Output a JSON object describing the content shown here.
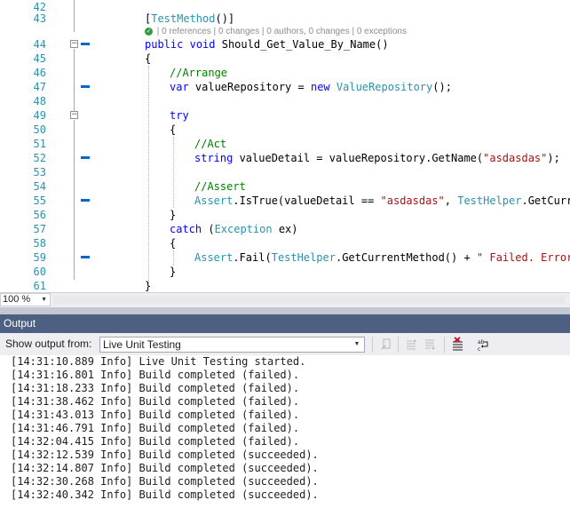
{
  "editor": {
    "lines": [
      {
        "num": "42",
        "code": ""
      },
      {
        "num": "43",
        "code": "    [TestMethod()]"
      },
      {
        "num": "44",
        "code": "    public void Should_Get_Value_By_Name()"
      },
      {
        "num": "45",
        "code": "    {"
      },
      {
        "num": "46",
        "code": "        //Arrange"
      },
      {
        "num": "47",
        "code": "        var valueRepository = new ValueRepository();"
      },
      {
        "num": "48",
        "code": ""
      },
      {
        "num": "49",
        "code": "        try"
      },
      {
        "num": "50",
        "code": "        {"
      },
      {
        "num": "51",
        "code": "            //Act"
      },
      {
        "num": "52",
        "code": "            string valueDetail = valueRepository.GetName(\"asdasdas\");"
      },
      {
        "num": "53",
        "code": ""
      },
      {
        "num": "54",
        "code": "            //Assert"
      },
      {
        "num": "55",
        "code": "            Assert.IsTrue(valueDetail == \"asdasdas\", TestHelper.GetCurrentMethod() + \" Failed\");"
      },
      {
        "num": "56",
        "code": "        }"
      },
      {
        "num": "57",
        "code": "        catch (Exception ex)"
      },
      {
        "num": "58",
        "code": "        {"
      },
      {
        "num": "59",
        "code": "            Assert.Fail(TestHelper.GetCurrentMethod() + \" Failed. Error: \" + ex.Message);"
      },
      {
        "num": "60",
        "code": "        }"
      },
      {
        "num": "61",
        "code": "    }"
      }
    ],
    "codelens": [
      "0 references",
      "0 changes",
      "0 authors, 0 changes",
      "0 exceptions"
    ],
    "zoom": "100 %"
  },
  "output": {
    "title": "Output",
    "show_output_from_label": "Show output from:",
    "selected_source": "Live Unit Testing",
    "lines": [
      "[14:31:10.889 Info] Live Unit Testing started.",
      "[14:31:16.801 Info] Build completed (failed).",
      "[14:31:18.233 Info] Build completed (failed).",
      "[14:31:38.462 Info] Build completed (failed).",
      "[14:31:43.013 Info] Build completed (failed).",
      "[14:31:46.791 Info] Build completed (failed).",
      "[14:32:04.415 Info] Build completed (failed).",
      "[14:32:12.539 Info] Build completed (succeeded).",
      "[14:32:14.807 Info] Build completed (succeeded).",
      "[14:32:30.268 Info] Build completed (succeeded).",
      "[14:32:40.342 Info] Build completed (succeeded)."
    ]
  },
  "icons": {
    "checkmark": "check-icon",
    "find": "find-in-output-icon",
    "prev": "previous-message-icon",
    "next": "next-message-icon",
    "clear": "clear-all-icon",
    "wrap": "word-wrap-icon"
  },
  "colors": {
    "line_number": "#2b91af",
    "keyword": "#0000ff",
    "type": "#2b91af",
    "comment": "#008000",
    "string": "#a31515",
    "output_title_bar": "#4d6082"
  }
}
